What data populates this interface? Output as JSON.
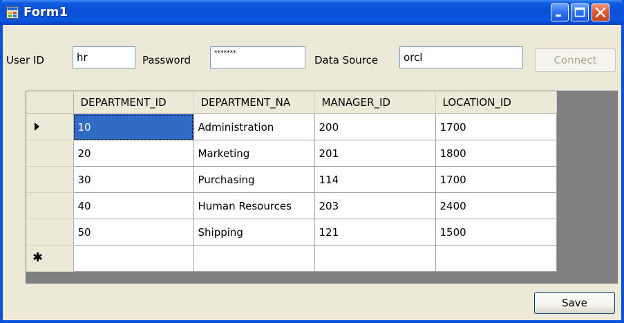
{
  "window": {
    "title": "Form1"
  },
  "form": {
    "user_id_label": "User ID",
    "user_id_value": "hr",
    "password_label": "Password",
    "password_value": "*******",
    "data_source_label": "Data Source",
    "data_source_value": "orcl",
    "connect_label": "Connect",
    "save_label": "Save"
  },
  "grid": {
    "columns": [
      "DEPARTMENT_ID",
      "DEPARTMENT_NA",
      "MANAGER_ID",
      "LOCATION_ID"
    ],
    "rows": [
      [
        "10",
        "Administration",
        "200",
        "1700"
      ],
      [
        "20",
        "Marketing",
        "201",
        "1800"
      ],
      [
        "30",
        "Purchasing",
        "114",
        "1700"
      ],
      [
        "40",
        "Human Resources",
        "203",
        "2400"
      ],
      [
        "50",
        "Shipping",
        "121",
        "1500"
      ]
    ],
    "current_row_marker": "▶",
    "new_row_marker": "✱"
  },
  "icons": {
    "app": "form-app-icon",
    "minimize": "minimize-icon",
    "maximize": "maximize-icon",
    "close": "close-icon",
    "current_row": "current-row-arrow-icon",
    "new_row": "new-row-asterisk-icon"
  },
  "colors": {
    "titlebar": "#0a4fd6",
    "selection": "#316ac5",
    "grid_background": "#808080",
    "form_background": "#ece9d8"
  }
}
